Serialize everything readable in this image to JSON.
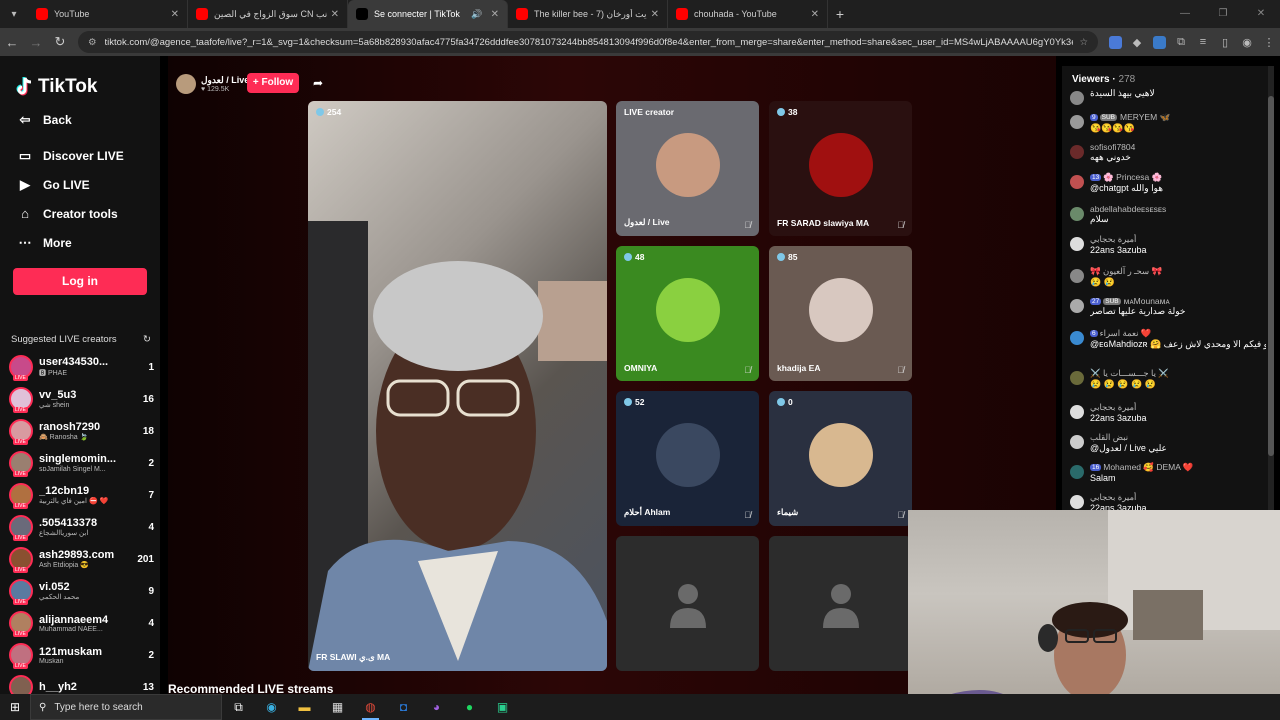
{
  "browser": {
    "tabs": [
      {
        "title": "YouTube",
        "favicon_color": "#ff0000",
        "active": false,
        "audio": false
      },
      {
        "title": "سوق الزواج في الصين CN الجانب",
        "favicon_color": "#ff0000",
        "active": false,
        "audio": false
      },
      {
        "title": "Se connecter | TikTok",
        "favicon_color": "#000000",
        "active": true,
        "audio": true
      },
      {
        "title": "The killer bee - ايت أورخان (7AD",
        "favicon_color": "#ff0000",
        "active": false,
        "audio": false
      },
      {
        "title": "chouhada - YouTube",
        "favicon_color": "#ff0000",
        "active": false,
        "audio": false
      }
    ],
    "url": "tiktok.com/@agence_taafofe/live?_r=1&_svg=1&checksum=5a68b828930afac4775fa34726dddfee30781073244bb854813094f996d0f8e4&enter_from_merge=share&enter_method=share&sec_user_id=MS4wLjABAAAAU6gY0Yk3e2..."
  },
  "sidebar": {
    "logo": "TikTok",
    "back": "Back",
    "menu": [
      {
        "label": "Discover LIVE",
        "icon": "tv-icon"
      },
      {
        "label": "Go LIVE",
        "icon": "video-camera-icon"
      },
      {
        "label": "Creator tools",
        "icon": "house-icon"
      },
      {
        "label": "More",
        "icon": "more-icon"
      }
    ],
    "login": "Log in",
    "suggested_title": "Suggested LIVE creators",
    "creators": [
      {
        "name": "user434530...",
        "sub": "🅱 PHAE",
        "count": "1",
        "color": "#c84a8a"
      },
      {
        "name": "vv_5u3",
        "sub": "شي shein",
        "count": "16",
        "color": "#e0c0d8"
      },
      {
        "name": "ranosh7290",
        "sub": "🙈 Ranosha 🍃",
        "count": "18",
        "color": "#d89aa0"
      },
      {
        "name": "singlemomin...",
        "sub": "ꜱᴅJamilah Singel M...",
        "count": "2",
        "color": "#9a7f70"
      },
      {
        "name": "_12cbn19",
        "sub": "امين فاي بالتربية ⛔ ❤️",
        "count": "7",
        "color": "#b07040"
      },
      {
        "name": ".505413378",
        "sub": "ابن سورياالشجاع",
        "count": "4",
        "color": "#6a6a7a"
      },
      {
        "name": "ash29893.com",
        "sub": "Ash Etdiopia 😎",
        "count": "201",
        "color": "#8a5030"
      },
      {
        "name": "vi.052",
        "sub": "محمد الحكمي",
        "count": "9",
        "color": "#5a7aa0"
      },
      {
        "name": "alijannaeem4",
        "sub": "Muhammad NAEE...",
        "count": "4",
        "color": "#b08060"
      },
      {
        "name": "121muskam",
        "sub": "Muskan",
        "count": "2",
        "color": "#c07080"
      },
      {
        "name": "h__yh2",
        "sub": "",
        "count": "13",
        "color": "#806050"
      }
    ]
  },
  "live": {
    "host_name": "لعدول / Live",
    "host_likes": "129.5K",
    "follow": "+ Follow",
    "main_count": "254",
    "main_label": "FR SLAWI ى.ي MA",
    "tiles": [
      {
        "badge": "LIVE creator",
        "label": "لعدول / Live",
        "bg": "#6a6a70",
        "circle": "#c89a80"
      },
      {
        "badge": "38",
        "label": "FR SARAD slawiya MA",
        "bg": "#2a1010",
        "circle": "#a01010"
      },
      {
        "badge": "48",
        "label": "OMNIYA",
        "bg": "#3a8a20",
        "circle": "#8ad040"
      },
      {
        "badge": "85",
        "label": "khadija ΕΑ",
        "bg": "#6a5a52",
        "circle": "#d8c8c0"
      },
      {
        "badge": "52",
        "label": "أحلام Ahlam",
        "bg": "#1a2438",
        "circle": "#3a4860"
      },
      {
        "badge": "0",
        "label": "شيماء",
        "bg": "#2a3040",
        "circle": "#d8b890"
      },
      {
        "badge": "",
        "label": "",
        "bg": "#2c2c2c",
        "circle": ""
      },
      {
        "badge": "",
        "label": "",
        "bg": "#2c2c2c",
        "circle": ""
      }
    ],
    "recommended": "Recommended LIVE streams"
  },
  "chat": {
    "viewers_label": "Viewers",
    "viewers_count": "278",
    "messages": [
      {
        "name": "",
        "level": "",
        "sub": "",
        "text": "لاهيي بيهذ السيدة",
        "color": "#888"
      },
      {
        "name": "MERYEM 🦋",
        "level": "9",
        "sub": "SUB",
        "text": "😘😘😘😘",
        "color": "#999"
      },
      {
        "name": "sofisofi7804",
        "level": "",
        "sub": "",
        "text": "خدوني ههه",
        "color": "#6a2a2a"
      },
      {
        "name": "🌸 Princesa 🌸",
        "level": "13",
        "sub": "",
        "text": "@chatgpt هوا والله",
        "color": "#c05050"
      },
      {
        "name": "abdellahabdeᴇsᴇsᴇs",
        "level": "",
        "sub": "",
        "text": "سلام",
        "color": "#6a8a6a"
      },
      {
        "name": "أميرة بحجابي",
        "level": "",
        "sub": "",
        "text": "22ans 3azuba",
        "color": "#ddd"
      },
      {
        "name": "🎀 سحـ ر آلعيون 🎀",
        "level": "",
        "sub": "",
        "text": "😢 😢",
        "color": "#888"
      },
      {
        "name": "ᴍᴀMounaᴍᴀ",
        "level": "27",
        "sub": "SUB",
        "text": "خولة صدارية عليها تصاصر",
        "color": "#aaa"
      },
      {
        "name": "نعمة اسراء ❤️",
        "level": "6",
        "sub": "",
        "text": "@ᴇɢMahdiozʀ 🤗 كحلو فكواشي واش حدا كندحلو فيكم الا ومحدي لاش زعف",
        "color": "#3a8ad0"
      },
      {
        "name": "⚔️ يا جـــســـات يا ⚔️",
        "level": "",
        "sub": "",
        "text": "😢 😢 😢 😢 😢",
        "color": "#6a6a3a"
      },
      {
        "name": "أميرة بحجابي",
        "level": "",
        "sub": "",
        "text": "22ans 3azuba",
        "color": "#ddd"
      },
      {
        "name": "نبض القلب",
        "level": "",
        "sub": "",
        "text": "@لعدول / Live عليي",
        "color": "#ccc"
      },
      {
        "name": "Mohamed 🥰 DEMA ❤️",
        "level": "16",
        "sub": "",
        "text": "Salam",
        "color": "#2a6a6a"
      },
      {
        "name": "أميرة بحجابي",
        "level": "",
        "sub": "",
        "text": "22ans 3azuba",
        "color": "#ddd"
      }
    ]
  },
  "taskbar": {
    "search_placeholder": "Type here to search"
  }
}
